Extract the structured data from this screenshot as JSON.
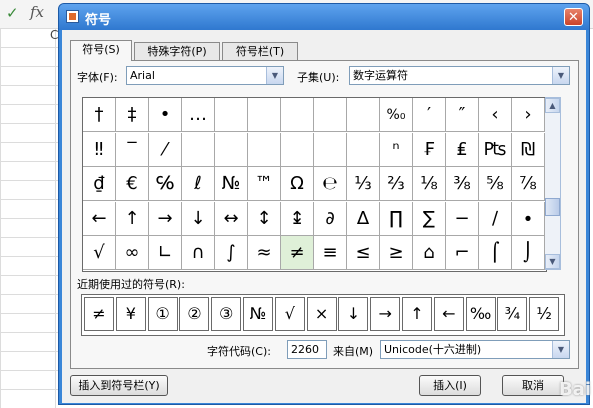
{
  "spreadsheet": {
    "check_icon": "check-icon",
    "fx_label": "fx",
    "column_letter": "C"
  },
  "dialog": {
    "title": "符号",
    "close_label": "✕",
    "tabs": [
      {
        "label": "符号(S)",
        "active": true
      },
      {
        "label": "特殊字符(P)",
        "active": false
      },
      {
        "label": "符号栏(T)",
        "active": false
      }
    ],
    "font_label": "字体(F):",
    "font_value": "Arial",
    "subset_label": "子集(U):",
    "subset_value": "数字运算符",
    "symbol_rows": [
      [
        "†",
        "‡",
        "•",
        "…",
        "",
        "",
        "",
        "",
        "",
        "%₀",
        "′",
        "″",
        "‹",
        "›"
      ],
      [
        "‼",
        "‾",
        "⁄",
        "",
        "",
        "",
        "",
        "",
        "",
        "ⁿ",
        "₣",
        "₤",
        "₧",
        "₪"
      ],
      [
        "₫",
        "€",
        "℅",
        "ℓ",
        "№",
        "™",
        "Ω",
        "℮",
        "⅓",
        "⅔",
        "⅛",
        "⅜",
        "⅝",
        "⅞"
      ],
      [
        "←",
        "↑",
        "→",
        "↓",
        "↔",
        "↕",
        "↨",
        "∂",
        "∆",
        "∏",
        "∑",
        "−",
        "∕",
        "∙"
      ],
      [
        "√",
        "∞",
        "∟",
        "∩",
        "∫",
        "≈",
        "≠",
        "≡",
        "≤",
        "≥",
        "⌂",
        "⌐",
        "⌠",
        "⌡"
      ]
    ],
    "selected_symbol": "≠",
    "recent_label": "近期使用过的符号(R):",
    "recent_symbols": [
      "≠",
      "¥",
      "①",
      "②",
      "③",
      "№",
      "√",
      "×",
      "↓",
      "→",
      "↑",
      "←",
      "‰",
      "¾",
      "½"
    ],
    "char_code_label": "字符代码(C):",
    "char_code_value": "2260",
    "from_label": "来自(M)",
    "from_value": "Unicode(十六进制)",
    "insert_to_bar_button": "插入到符号栏(Y)",
    "insert_button": "插入(I)",
    "cancel_button": "取消"
  },
  "watermark": "Bai"
}
